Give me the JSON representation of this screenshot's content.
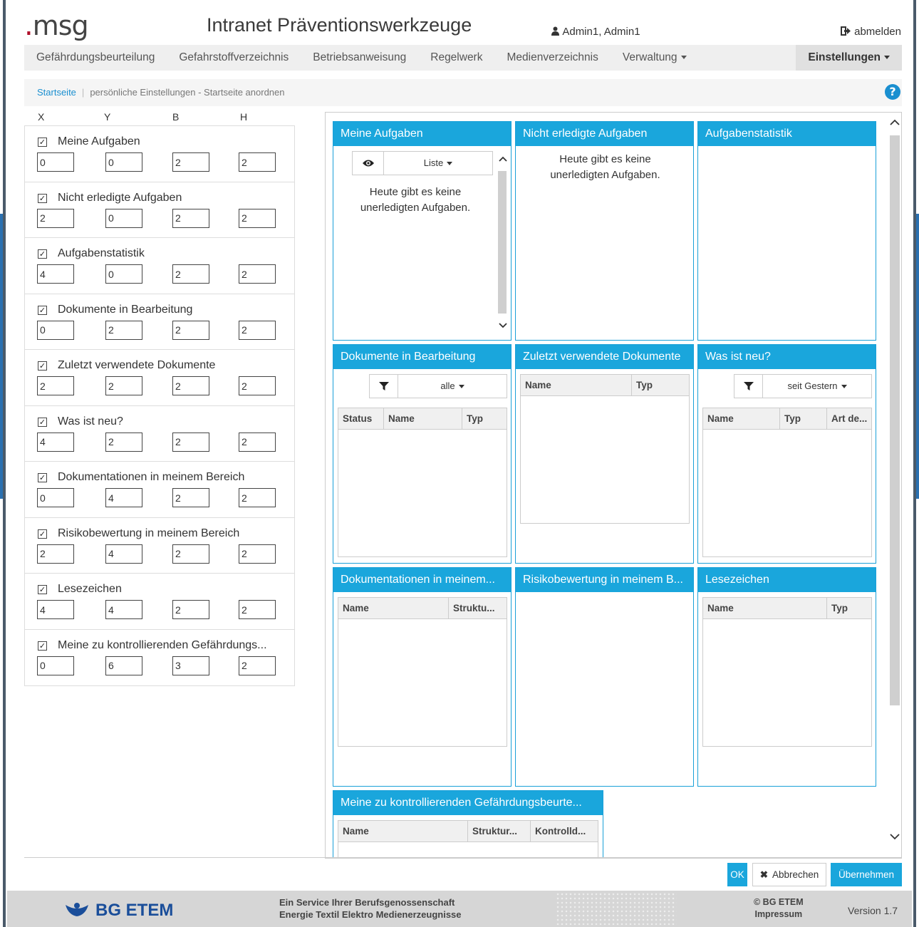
{
  "header": {
    "logo_dot": ".",
    "logo_text": "msg",
    "app_title": "Intranet Präventionswerkzeuge",
    "user": "Admin1, Admin1",
    "logout_label": "abmelden"
  },
  "nav": {
    "items": [
      "Gefährdungsbeurteilung",
      "Gefahrstoffverzeichnis",
      "Betriebsanweisung",
      "Regelwerk",
      "Medienverzeichnis",
      "Verwaltung",
      "Einstellungen"
    ]
  },
  "breadcrumb": {
    "home": "Startseite",
    "current": "persönliche Einstellungen - Startseite anordnen",
    "help": "?"
  },
  "settings": {
    "col_x": "X",
    "col_y": "Y",
    "col_b": "B",
    "col_h": "H",
    "items": [
      {
        "label": "Meine Aufgaben",
        "x": "0",
        "y": "0",
        "b": "2",
        "h": "2"
      },
      {
        "label": "Nicht erledigte Aufgaben",
        "x": "2",
        "y": "0",
        "b": "2",
        "h": "2"
      },
      {
        "label": "Aufgabenstatistik",
        "x": "4",
        "y": "0",
        "b": "2",
        "h": "2"
      },
      {
        "label": "Dokumente in Bearbeitung",
        "x": "0",
        "y": "2",
        "b": "2",
        "h": "2"
      },
      {
        "label": "Zuletzt verwendete Dokumente",
        "x": "2",
        "y": "2",
        "b": "2",
        "h": "2"
      },
      {
        "label": "Was ist neu?",
        "x": "4",
        "y": "2",
        "b": "2",
        "h": "2"
      },
      {
        "label": "Dokumentationen in meinem Bereich",
        "x": "0",
        "y": "4",
        "b": "2",
        "h": "2"
      },
      {
        "label": "Risikobewertung in meinem Bereich",
        "x": "2",
        "y": "4",
        "b": "2",
        "h": "2"
      },
      {
        "label": "Lesezeichen",
        "x": "4",
        "y": "4",
        "b": "2",
        "h": "2"
      },
      {
        "label": "Meine zu kontrollierenden Gefährdungs...",
        "x": "0",
        "y": "6",
        "b": "3",
        "h": "2"
      }
    ]
  },
  "widgets": {
    "meine_aufgaben": {
      "title": "Meine Aufgaben",
      "select": "Liste",
      "empty_1": "Heute gibt es keine",
      "empty_2": "unerledigten Aufgaben."
    },
    "nicht_erledigt": {
      "title": "Nicht erledigte Aufgaben",
      "empty_1": "Heute gibt es keine",
      "empty_2": "unerledigten Aufgaben."
    },
    "statistik": {
      "title": "Aufgabenstatistik"
    },
    "dok_bearbeitung": {
      "title": "Dokumente in Bearbeitung",
      "select": "alle",
      "cols": [
        "Status",
        "Name",
        "Typ"
      ]
    },
    "zuletzt": {
      "title": "Zuletzt verwendete Dokumente",
      "cols": [
        "Name",
        "Typ"
      ]
    },
    "was_ist_neu": {
      "title": "Was ist neu?",
      "select": "seit Gestern",
      "cols": [
        "Name",
        "Typ",
        "Art de..."
      ]
    },
    "dokumentationen": {
      "title": "Dokumentationen in meinem...",
      "cols": [
        "Name",
        "Struktu..."
      ]
    },
    "risiko": {
      "title": "Risikobewertung in meinem B..."
    },
    "lesezeichen": {
      "title": "Lesezeichen",
      "cols": [
        "Name",
        "Typ"
      ]
    },
    "kontrolle": {
      "title": "Meine zu kontrollierenden Gefährdungsbeurte...",
      "cols": [
        "Name",
        "Struktur...",
        "Kontrolld..."
      ]
    }
  },
  "buttons": {
    "ok": "OK",
    "cancel": "Abbrechen",
    "apply": "Übernehmen"
  },
  "footer": {
    "org": "BG ETEM",
    "service_1": "Ein Service Ihrer Berufsgenossenschaft",
    "service_2": "Energie Textil Elektro Medienerzeugnisse",
    "copyright": "© BG ETEM",
    "impressum": "Impressum",
    "version": "Version 1.7"
  },
  "colors": {
    "accent": "#1aa6dc",
    "logo_dot": "#b0102a",
    "footer_logo": "#1a4e9a"
  },
  "icons": [
    "user-icon",
    "logout-icon",
    "help-icon",
    "eye-icon",
    "filter-icon",
    "chevron-up-icon",
    "chevron-down-icon",
    "close-icon",
    "bg-etem-logo-icon"
  ]
}
